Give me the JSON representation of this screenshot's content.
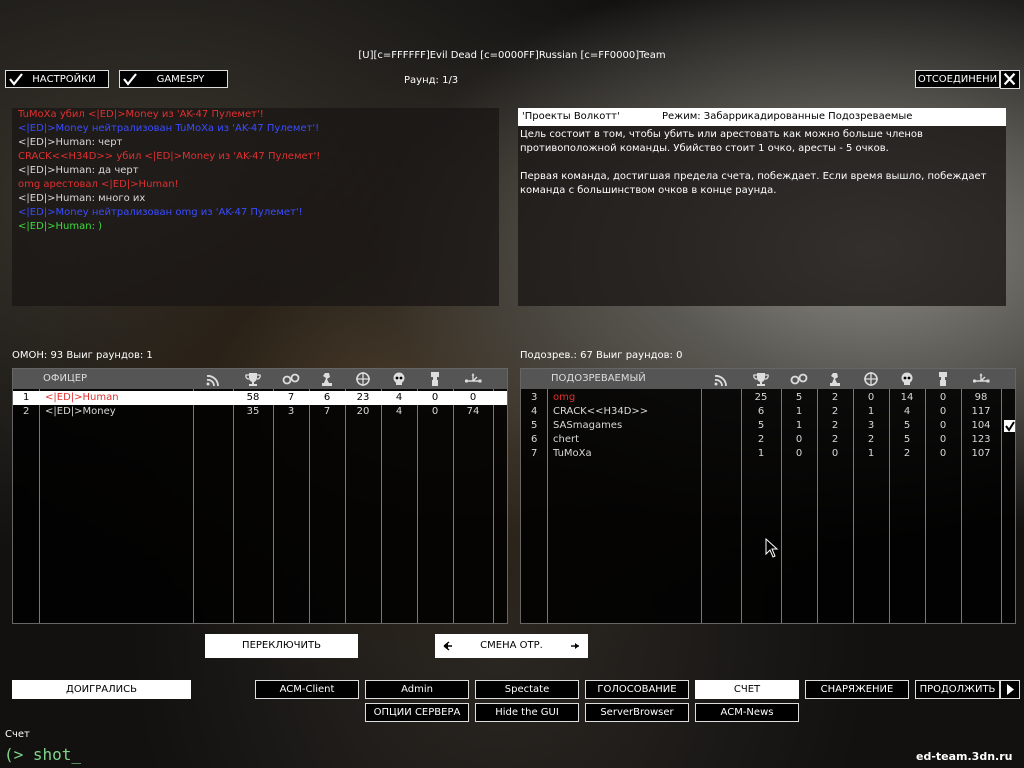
{
  "window_title": "[U][c=FFFFFF]Evil Dead [c=0000FF]Russian [c=FF0000]Team",
  "top_buttons": {
    "settings": "НАСТРОЙКИ",
    "gamespy": "GAMESPY",
    "disconnect": "ОТСОЕДИНЕНИ"
  },
  "round": "Раунд: 1/3",
  "chat": [
    {
      "text": "TuMoXa убил <|ED|>Money из 'AK-47 Пулемет'!",
      "color": "#e03030"
    },
    {
      "text": "<|ED|>Money нейтрализован TuMoXa из 'AK-47 Пулемет'!",
      "color": "#3a4cff"
    },
    {
      "text": "<|ED|>Human: черт",
      "color": "#d8d8d8"
    },
    {
      "text": "CRACK<<H34D>> убил <|ED|>Money из 'AK-47 Пулемет'!",
      "color": "#e03030"
    },
    {
      "text": "<|ED|>Human: да черт",
      "color": "#d8d8d8"
    },
    {
      "text": "omg арестовал <|ED|>Human!",
      "color": "#e03030"
    },
    {
      "text": "<|ED|>Human: много их",
      "color": "#d8d8d8"
    },
    {
      "text": "<|ED|>Money нейтрализован omg из 'AK-47 Пулемет'!",
      "color": "#3a4cff"
    },
    {
      "text": "<|ED|>Human: )",
      "color": "#3cdc3c"
    }
  ],
  "mode_panel": {
    "map": "'Проекты Волкотт'",
    "mode": "Режим: Забаррикадированные Подозреваемые",
    "lines": [
      "Цель состоит в том, чтобы убить или арестовать как можно больше членов",
      "противоположной команды. Убийство стоит 1 очко, аресты - 5 очков.",
      "",
      "Первая команда, достигшая предела счета, побеждает. Если время вышло, побеждает",
      "команда с большинством очков в конце раунда."
    ]
  },
  "team_left": {
    "summary": "ОМОН: 93   Выиг раундов: 1",
    "column_title": "ОФИЦЕР",
    "rows": [
      {
        "cells": [
          "1",
          "<|ED|>Human",
          "",
          "58",
          "7",
          "6",
          "23",
          "4",
          "0",
          "0"
        ],
        "highlight": true
      },
      {
        "cells": [
          "2",
          "<|ED|>Money",
          "",
          "35",
          "3",
          "7",
          "20",
          "4",
          "0",
          "74"
        ],
        "highlight": false
      }
    ]
  },
  "team_right": {
    "summary": "Подозрев.: 67   Выиг раундов: 0",
    "column_title": "ПОДОЗРЕВАЕМЫЙ",
    "rows": [
      {
        "cells": [
          "3",
          "omg",
          "",
          "25",
          "5",
          "2",
          "0",
          "14",
          "0",
          "98"
        ],
        "name_color": "#e03030",
        "check": false
      },
      {
        "cells": [
          "4",
          "CRACK<<H34D>>",
          "",
          "6",
          "1",
          "2",
          "1",
          "4",
          "0",
          "117"
        ],
        "name_color": "#d8d8d8",
        "check": false
      },
      {
        "cells": [
          "5",
          "SASmagames",
          "",
          "5",
          "1",
          "2",
          "3",
          "5",
          "0",
          "104"
        ],
        "name_color": "#d8d8d8",
        "check": true
      },
      {
        "cells": [
          "6",
          "chert",
          "",
          "2",
          "0",
          "2",
          "2",
          "5",
          "0",
          "123"
        ],
        "name_color": "#d8d8d8",
        "check": false
      },
      {
        "cells": [
          "7",
          "TuMoXa",
          "",
          "1",
          "0",
          "0",
          "1",
          "2",
          "0",
          "107"
        ],
        "name_color": "#d8d8d8",
        "check": false
      }
    ]
  },
  "column_icons": [
    "signal-icon",
    "trophy-icon",
    "handcuffs-icon",
    "chess-piece-icon",
    "crosshair-icon",
    "skull-icon",
    "medal-icon",
    "usb-icon"
  ],
  "switch_button": "ПЕРЕКЛЮЧИТЬ",
  "change_team": "СМЕНА ОТР.",
  "bottom": {
    "finish": "ДОИГРАЛИСЬ",
    "row1": [
      "ACM-Client",
      "Admin",
      "Spectate",
      "ГОЛОСОВАНИЕ",
      "СЧЕТ",
      "СНАРЯЖЕНИЕ",
      "ПРОДОЛЖИТЬ"
    ],
    "row2": [
      "ОПЦИИ СЕРВЕРА",
      "Hide the GUI",
      "ServerBrowser",
      "ACM-News"
    ]
  },
  "status_label": "Счет",
  "console_text": "(> shot_",
  "watermark": "ed-team.3dn.ru",
  "colors": {
    "accent_red": "#e03030",
    "accent_blue": "#3a4cff",
    "accent_green": "#3cdc3c",
    "console_green": "#7fd48a"
  }
}
